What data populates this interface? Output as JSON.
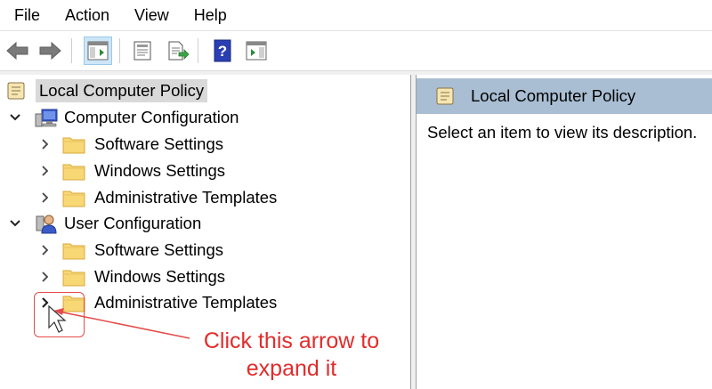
{
  "menubar": {
    "items": [
      "File",
      "Action",
      "View",
      "Help"
    ]
  },
  "toolbar": {
    "buttons": [
      "back-arrow-icon",
      "forward-arrow-icon",
      "show-hide-tree-icon",
      "properties-icon",
      "export-list-icon",
      "help-icon",
      "show-action-pane-icon"
    ],
    "active_button": "show-hide-tree-icon"
  },
  "tree": {
    "root": "Local Computer Policy",
    "computer_configuration": {
      "label": "Computer Configuration",
      "children": [
        "Software Settings",
        "Windows Settings",
        "Administrative Templates"
      ]
    },
    "user_configuration": {
      "label": "User Configuration",
      "children": [
        "Software Settings",
        "Windows Settings",
        "Administrative Templates"
      ]
    }
  },
  "right_pane": {
    "header": "Local Computer Policy",
    "description": "Select an item to view its description."
  },
  "annotation": {
    "line1": "Click this arrow to",
    "line2": "expand it",
    "color": "#e32b2b"
  },
  "colors": {
    "header_bg": "#a9bed3",
    "folder_fill": "#f8d775",
    "folder_stroke": "#d9a93a",
    "toolbar_active": "#cde6f7"
  }
}
